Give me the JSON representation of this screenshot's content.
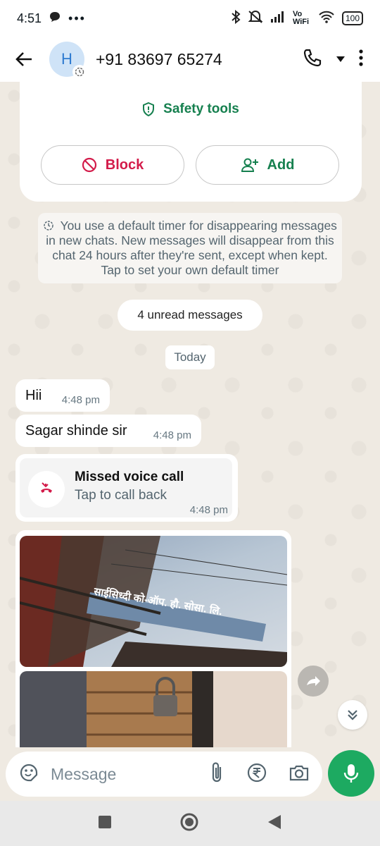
{
  "status_bar": {
    "time": "4:51",
    "network": "Vo WiFi",
    "battery": "100"
  },
  "header": {
    "avatar_initial": "H",
    "contact": "+91 83697 65274"
  },
  "card": {
    "safety_tools": "Safety tools",
    "block_label": "Block",
    "add_label": "Add"
  },
  "system_note": "You use a default timer for disappearing messages in new chats. New messages will disappear from this chat 24 hours after they're sent, except when kept. Tap to set your own default timer",
  "unread_label": "4 unread messages",
  "date_label": "Today",
  "messages": [
    {
      "text": "Hii",
      "time": "4:48 pm"
    },
    {
      "text": "Sagar shinde sir",
      "time": "4:48 pm"
    }
  ],
  "call": {
    "title": "Missed voice call",
    "subtitle": "Tap to call back",
    "time": "4:48 pm"
  },
  "photo_sign_text": "साईसिध्दी को-ऑप. हौ. सोसा. लि.",
  "composer": {
    "placeholder": "Message"
  },
  "colors": {
    "accent_green": "#1daa61",
    "block_red": "#d31b4a",
    "chat_bg": "#efeae2"
  }
}
